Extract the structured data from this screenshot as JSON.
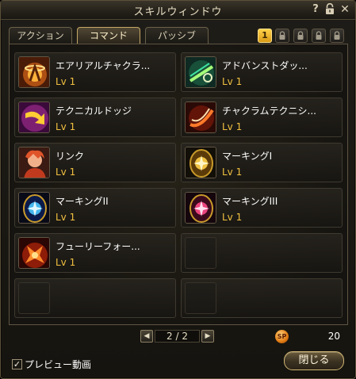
{
  "window": {
    "title": "スキルウィンドウ"
  },
  "titlebar_icons": [
    "help-icon",
    "lock-icon",
    "close-icon"
  ],
  "titlebar": {
    "help": "?",
    "close": "✕"
  },
  "tabs": [
    {
      "label": "アクション",
      "active": false
    },
    {
      "label": "コマンド",
      "active": true
    },
    {
      "label": "パッシブ",
      "active": false
    }
  ],
  "pages": [
    {
      "label": "1",
      "locked": false,
      "active": true
    },
    {
      "label": "",
      "locked": true,
      "active": false
    },
    {
      "label": "",
      "locked": true,
      "active": false
    },
    {
      "label": "",
      "locked": true,
      "active": false
    },
    {
      "label": "",
      "locked": true,
      "active": false
    }
  ],
  "skills": [
    {
      "name": "エアリアルチャクラ...",
      "level": "Lv 1",
      "icon": "aerial-chakram-icon"
    },
    {
      "name": "アドバンストダッ...",
      "level": "Lv 1",
      "icon": "advanced-dash-icon"
    },
    {
      "name": "テクニカルドッジ",
      "level": "Lv 1",
      "icon": "technical-dodge-icon"
    },
    {
      "name": "チャクラムテクニシ...",
      "level": "Lv 1",
      "icon": "chakram-technique-icon"
    },
    {
      "name": "リンク",
      "level": "Lv 1",
      "icon": "link-icon"
    },
    {
      "name": "マーキングI",
      "level": "Lv 1",
      "icon": "marking-1-icon"
    },
    {
      "name": "マーキングII",
      "level": "Lv 1",
      "icon": "marking-2-icon"
    },
    {
      "name": "マーキングIII",
      "level": "Lv 1",
      "icon": "marking-3-icon"
    },
    {
      "name": "フューリーフォー...",
      "level": "Lv 1",
      "icon": "fury-force-icon"
    }
  ],
  "empty_slots": 3,
  "pager": {
    "text": "2 / 2",
    "prev": "◀",
    "next": "▶"
  },
  "sp": {
    "label": "SP",
    "value": "20"
  },
  "footer": {
    "preview_label": "プレビュー動画",
    "preview_checked": "✓",
    "close_label": "閉じる"
  },
  "colors": {
    "level": "#f0c040",
    "accent": "#c6a866",
    "active_page": "#ffd24a"
  }
}
